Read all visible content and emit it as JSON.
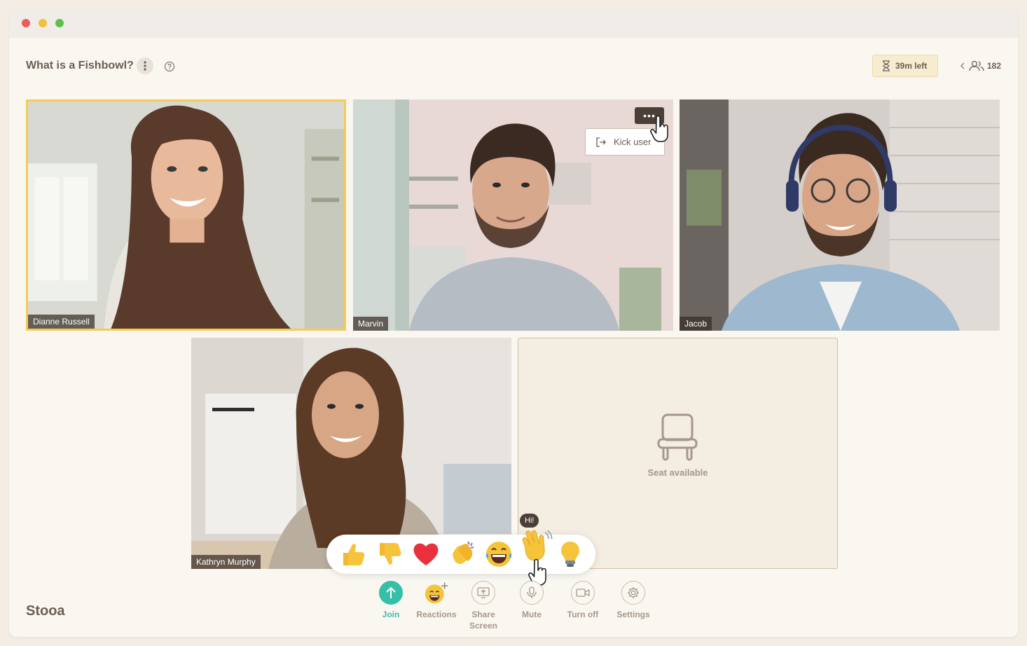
{
  "header": {
    "title": "What is a Fishbowl?",
    "timer": "39m left",
    "participants_count": "182"
  },
  "tiles": [
    {
      "name": "Dianne Russell",
      "active_speaker": true
    },
    {
      "name": "Marvin"
    },
    {
      "name": "Jacob"
    },
    {
      "name": "Kathryn Murphy"
    }
  ],
  "menu": {
    "more_glyph": "•••",
    "kick_label": "Kick user"
  },
  "seat": {
    "label": "Seat available"
  },
  "reactions": {
    "tooltip": "Hi!",
    "items": [
      "thumbs-up",
      "thumbs-down",
      "heart",
      "clapping",
      "laughing",
      "waving-hand",
      "light-bulb"
    ]
  },
  "toolbar": {
    "join": "Join",
    "reactions": "Reactions",
    "share_screen_line1": "Share",
    "share_screen_line2": "Screen",
    "mute": "Mute",
    "camera": "Turn off",
    "settings": "Settings"
  },
  "brand": "Stooa",
  "colors": {
    "accent_teal": "#36bfa7",
    "active_border": "#f5cb55",
    "text_brown": "#6b5d54",
    "muted": "#a6978a"
  }
}
